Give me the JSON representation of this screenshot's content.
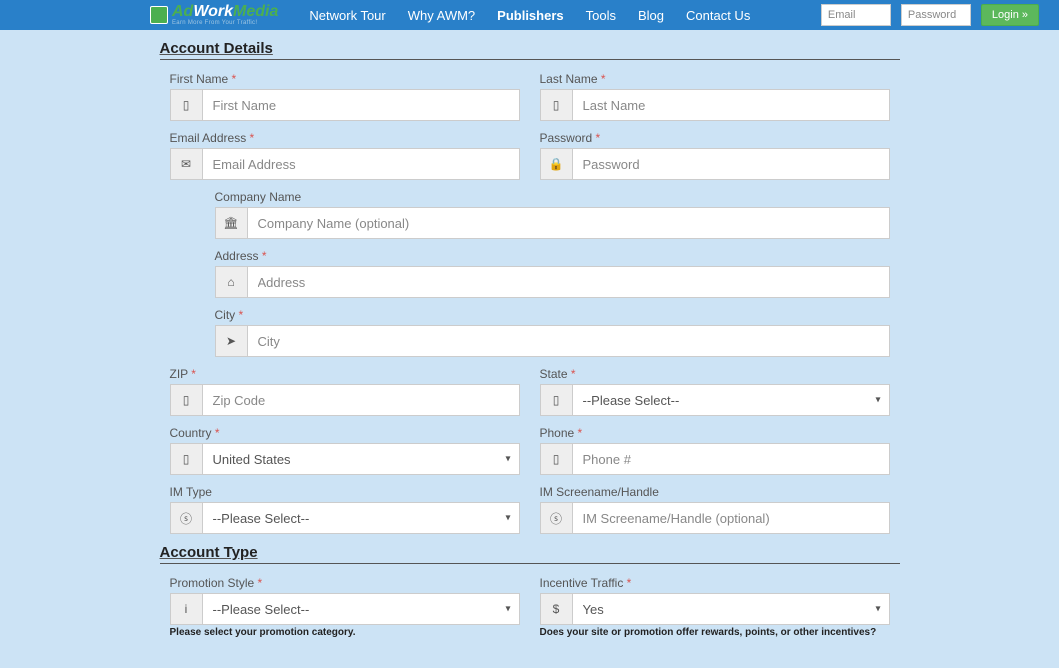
{
  "logo": {
    "ad": "Ad",
    "work": "Work",
    "media": "Media",
    "tagline": "Earn More From Your Traffic!"
  },
  "nav": {
    "tour": "Network Tour",
    "why": "Why AWM?",
    "publishers": "Publishers",
    "tools": "Tools",
    "blog": "Blog",
    "contact": "Contact Us"
  },
  "login": {
    "email_ph": "Email",
    "password_ph": "Password",
    "button": "Login »"
  },
  "sections": {
    "account": "Account Details",
    "accountType": "Account Type"
  },
  "fields": {
    "first_name": {
      "label": "First Name",
      "ph": "First Name"
    },
    "last_name": {
      "label": "Last Name",
      "ph": "Last Name"
    },
    "email": {
      "label": "Email Address",
      "ph": "Email Address"
    },
    "password": {
      "label": "Password",
      "ph": "Password"
    },
    "company": {
      "label": "Company Name",
      "ph": "Company Name (optional)"
    },
    "address": {
      "label": "Address",
      "ph": "Address"
    },
    "city": {
      "label": "City",
      "ph": "City"
    },
    "zip": {
      "label": "ZIP",
      "ph": "Zip Code"
    },
    "state": {
      "label": "State",
      "selected": "--Please Select--"
    },
    "country": {
      "label": "Country",
      "selected": "United States"
    },
    "phone": {
      "label": "Phone",
      "ph": "Phone #"
    },
    "im_type": {
      "label": "IM Type",
      "selected": "--Please Select--"
    },
    "im_handle": {
      "label": "IM Screename/Handle",
      "ph": "IM Screename/Handle (optional)"
    },
    "promo_style": {
      "label": "Promotion Style",
      "selected": "--Please Select--",
      "helper": "Please select your promotion category."
    },
    "incentive": {
      "label": "Incentive Traffic",
      "selected": "Yes",
      "helper": "Does your site or promotion offer rewards, points, or other incentives?"
    }
  },
  "req": "*",
  "icons": {
    "mobile": "▯",
    "envelope": "✉",
    "lock": "🔒",
    "building": "🏛",
    "home": "⌂",
    "location": "➤",
    "skype": "ⓢ",
    "info": "i",
    "dollar": "$"
  }
}
